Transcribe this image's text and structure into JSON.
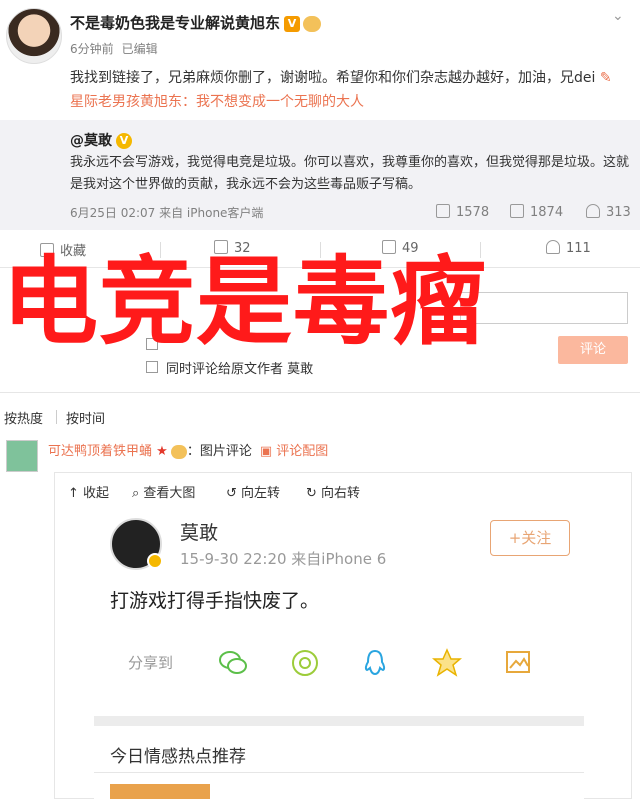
{
  "post": {
    "username": "不是毒奶色我是专业解说黄旭东",
    "time": "6分钟前",
    "edited": "已编辑",
    "text": "我找到链接了，兄弟麻烦你删了，谢谢啦。希望你和你们杂志越办越好，加油，兄dei",
    "link": "星际老男孩黄旭东：我不想变成一个无聊的大人"
  },
  "quote": {
    "author": "@莫敢",
    "text": "我永远不会写游戏，我觉得电竞是垃圾。你可以喜欢，我尊重你的喜欢，但我觉得那是垃圾。这就是我对这个世界做的贡献，我永远不会为这些毒品贩子写稿。",
    "meta": "6月25日 02:07 来自 iPhone客户端",
    "reposts": "1578",
    "comments": "1874",
    "likes": "313"
  },
  "actions": {
    "fav": "收藏",
    "reposts": "32",
    "comments": "49",
    "likes": "111"
  },
  "comment_box": {
    "submit": "评论",
    "also_post": "同时评论给原文作者 莫敢"
  },
  "overlay_text": "电竞是毒瘤",
  "sort": {
    "hot": "按热度",
    "time": "按时间"
  },
  "comment": {
    "name": "可达鸭顶着铁甲蛹",
    "suffix": "：图片评论",
    "pic": "评论配图"
  },
  "image_tools": {
    "collapse": "收起",
    "view_large": "查看大图",
    "rotate_left": "向左转",
    "rotate_right": "向右转"
  },
  "embedded": {
    "name": "莫敢",
    "time": "15-9-30 22:20  来自iPhone 6",
    "follow": "+关注",
    "text": "打游戏打得手指快废了。",
    "share_label": "分享到",
    "rec_title": "今日情感热点推荐"
  },
  "colors": {
    "accent": "#eb7350",
    "overlay": "#ff1a1a",
    "quote_bg": "#f2f2f5"
  }
}
